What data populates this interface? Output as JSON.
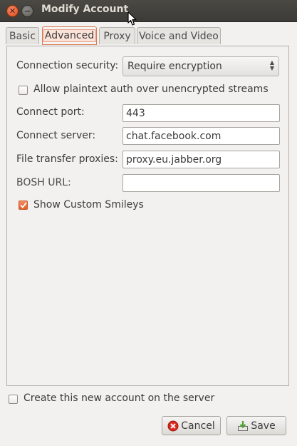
{
  "window": {
    "title": "Modify Account",
    "close_glyph": "✕",
    "minimize_glyph": "−"
  },
  "tabs": [
    {
      "label": "Basic",
      "active": false
    },
    {
      "label": "Advanced",
      "active": true
    },
    {
      "label": "Proxy",
      "active": false
    },
    {
      "label": "Voice and Video",
      "active": false
    }
  ],
  "advanced": {
    "connection_security_label": "Connection security:",
    "connection_security_value": "Require encryption",
    "plaintext_auth_label": "Allow plaintext auth over unencrypted streams",
    "plaintext_auth_checked": false,
    "connect_port_label": "Connect port:",
    "connect_port_value": "443",
    "connect_server_label": "Connect server:",
    "connect_server_value": "chat.facebook.com",
    "file_transfer_proxies_label": "File transfer proxies:",
    "file_transfer_proxies_value": "proxy.eu.jabber.org",
    "bosh_url_label": "BOSH URL:",
    "bosh_url_value": "",
    "show_smileys_label": "Show Custom Smileys",
    "show_smileys_checked": true
  },
  "footer": {
    "create_account_label": "Create this new account on the server",
    "create_account_checked": false,
    "cancel_label": "Cancel",
    "save_label": "Save"
  },
  "icons": {
    "cancel": "cancel-icon",
    "save": "save-icon"
  },
  "colors": {
    "accent": "#e0602c",
    "titlebar": "#3c3b37",
    "cancel_icon": "#d8281e",
    "save_icon": "#4aa02c"
  }
}
